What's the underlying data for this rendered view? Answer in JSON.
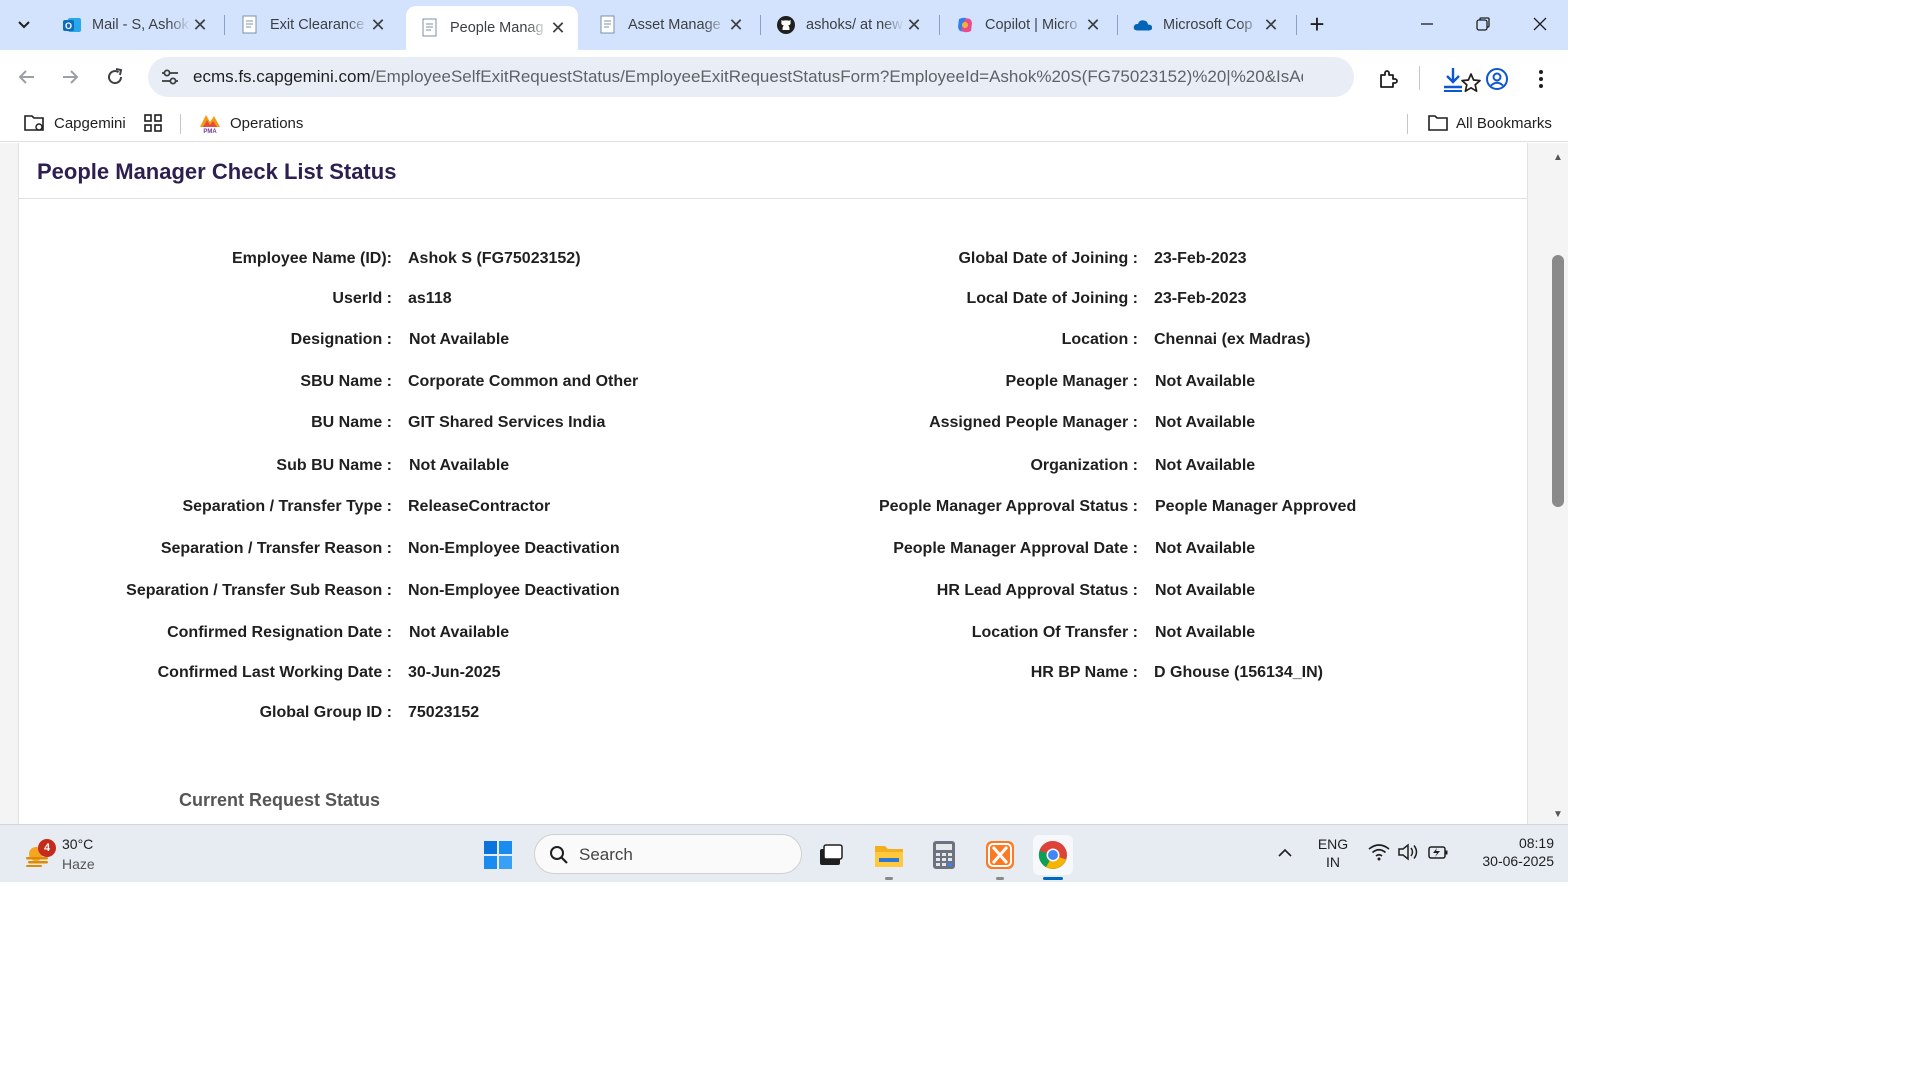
{
  "browser": {
    "tabs": [
      {
        "title": "Mail - S, Ashok",
        "icon": "outlook-icon",
        "active": false
      },
      {
        "title": "Exit Clearance",
        "icon": "document-icon",
        "active": false
      },
      {
        "title": "People Manag",
        "icon": "document-icon",
        "active": true
      },
      {
        "title": "Asset Manage",
        "icon": "document-icon",
        "active": false
      },
      {
        "title": "ashoks/ at new",
        "icon": "github-icon",
        "active": false
      },
      {
        "title": "Copilot | Micro",
        "icon": "copilot-icon",
        "active": false
      },
      {
        "title": "Microsoft Cop",
        "icon": "onedrive-icon",
        "active": false
      }
    ],
    "url_host": "ecms.fs.capgemini.com",
    "url_path": "/EmployeeSelfExitRequestStatus/EmployeeExitRequestStatusForm?EmployeeId=Ashok%20S(FG75023152)%20|%20&IsAd...",
    "bookmarks": [
      {
        "label": "Capgemini",
        "icon": "folder-icon"
      },
      {
        "label": "Operations",
        "icon": "pma-logo-icon"
      }
    ],
    "all_bookmarks_label": "All Bookmarks"
  },
  "page": {
    "title": "People Manager Check List Status",
    "left_fields": [
      {
        "label": "Employee Name (ID):",
        "value": "Ashok S (FG75023152)"
      },
      {
        "label": "UserId :",
        "value": "as118"
      },
      {
        "label": "Designation :",
        "value": "Not Available"
      },
      {
        "label": "SBU Name :",
        "value": "Corporate Common and Other"
      },
      {
        "label": "BU Name :",
        "value": "GIT Shared Services India"
      },
      {
        "label": "Sub BU Name :",
        "value": "Not Available"
      },
      {
        "label": "Separation / Transfer Type :",
        "value": "ReleaseContractor"
      },
      {
        "label": "Separation / Transfer Reason :",
        "value": "Non-Employee Deactivation"
      },
      {
        "label": "Separation / Transfer Sub Reason :",
        "value": "Non-Employee Deactivation"
      },
      {
        "label": "Confirmed Resignation Date :",
        "value": "Not Available"
      },
      {
        "label": "Confirmed Last Working Date :",
        "value": "30-Jun-2025"
      },
      {
        "label": "Global Group ID :",
        "value": "75023152"
      }
    ],
    "right_fields": [
      {
        "label": "Global Date of Joining :",
        "value": "23-Feb-2023"
      },
      {
        "label": "Local Date of Joining :",
        "value": "23-Feb-2023"
      },
      {
        "label": "Location :",
        "value": "Chennai (ex Madras)"
      },
      {
        "label": "People Manager :",
        "value": "Not Available"
      },
      {
        "label": "Assigned People Manager :",
        "value": "Not Available"
      },
      {
        "label": "Organization :",
        "value": "Not Available"
      },
      {
        "label": "People Manager Approval Status :",
        "value": "People Manager Approved"
      },
      {
        "label": "People Manager Approval Date :",
        "value": "Not Available"
      },
      {
        "label": "HR Lead Approval Status :",
        "value": "Not Available"
      },
      {
        "label": "Location Of Transfer :",
        "value": "Not Available"
      },
      {
        "label": "HR BP Name :",
        "value": "D Ghouse (156134_IN)"
      }
    ],
    "section_heading": "Current Request Status"
  },
  "taskbar": {
    "weather_temp": "30°C",
    "weather_cond": "Haze",
    "weather_badge": "4",
    "search_placeholder": "Search",
    "lang_top": "ENG",
    "lang_bottom": "IN",
    "time": "08:19",
    "date": "30-06-2025"
  },
  "colors": {
    "tabstrip_bg": "#d3e3fd",
    "title_color": "#2d1f4f",
    "accent_blue": "#0b57d0"
  }
}
